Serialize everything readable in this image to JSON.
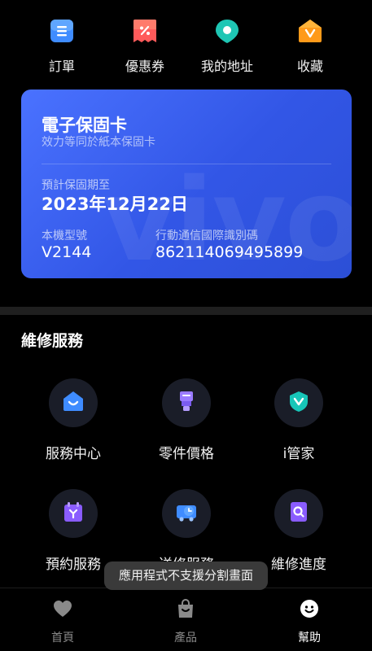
{
  "quick_actions": [
    {
      "label": "訂單",
      "icon": "order-icon"
    },
    {
      "label": "優惠券",
      "icon": "coupon-icon"
    },
    {
      "label": "我的地址",
      "icon": "location-icon"
    },
    {
      "label": "收藏",
      "icon": "favorites-icon"
    }
  ],
  "warranty_card": {
    "title": "電子保固卡",
    "subtitle": "效力等同於紙本保固卡",
    "expiry_label": "預計保固期至",
    "expiry_date": "2023年12月22日",
    "model_label": "本機型號",
    "model_value": "V2144",
    "imei_label": "行動通信國際識別碼",
    "imei_value": "862114069495899",
    "watermark": "vivo"
  },
  "services": {
    "title": "維修服務",
    "items": [
      {
        "label": "服務中心",
        "icon": "service-center-icon"
      },
      {
        "label": "零件價格",
        "icon": "parts-price-icon"
      },
      {
        "label": "i管家",
        "icon": "i-manager-icon"
      },
      {
        "label": "預約服務",
        "icon": "appointment-icon"
      },
      {
        "label": "送修服務",
        "icon": "repair-delivery-icon"
      },
      {
        "label": "維修進度",
        "icon": "repair-progress-icon"
      }
    ]
  },
  "toast": "應用程式不支援分割畫面",
  "bottom_nav": {
    "items": [
      {
        "label": "首頁",
        "icon": "heart-icon",
        "active": false
      },
      {
        "label": "產品",
        "icon": "bag-icon",
        "active": false
      },
      {
        "label": "幫助",
        "icon": "smiley-icon",
        "active": true
      }
    ]
  },
  "colors": {
    "card_gradient_start": "#4a72ff",
    "card_gradient_end": "#2c4fd6",
    "background": "#000000",
    "icon_circle": "#1a1d28"
  }
}
